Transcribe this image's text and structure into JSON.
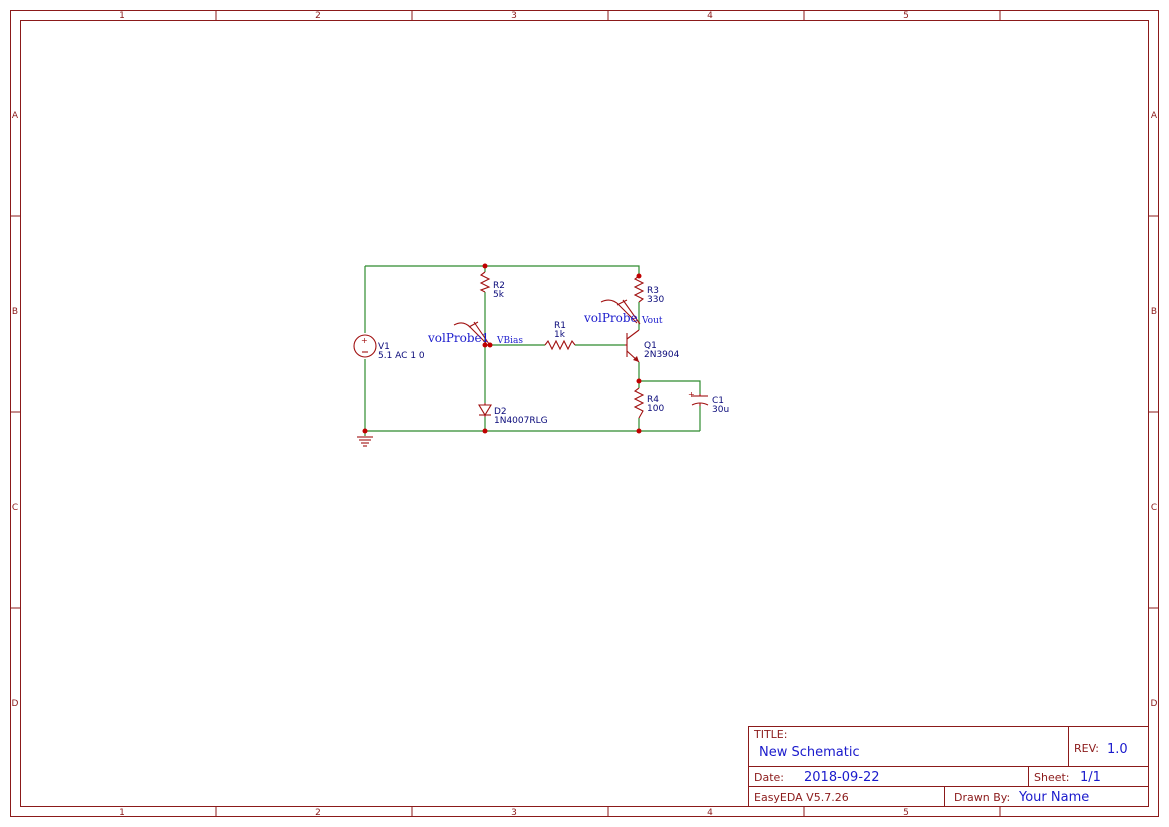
{
  "frame": {
    "col_labels": [
      "1",
      "2",
      "3",
      "4",
      "5"
    ],
    "row_labels": [
      "A",
      "B",
      "C",
      "D"
    ]
  },
  "components": {
    "v1": {
      "ref": "V1",
      "value": "5.1 AC 1 0"
    },
    "r2": {
      "ref": "R2",
      "value": "5k"
    },
    "r1": {
      "ref": "R1",
      "value": "1k"
    },
    "r3": {
      "ref": "R3",
      "value": "330"
    },
    "r4": {
      "ref": "R4",
      "value": "100"
    },
    "q1": {
      "ref": "Q1",
      "value": "2N3904"
    },
    "d2": {
      "ref": "D2",
      "value": "1N4007RLG"
    },
    "c1": {
      "ref": "C1",
      "value": "30u"
    }
  },
  "probes": {
    "probe1": {
      "name": "volProbe1",
      "net": "VBias"
    },
    "probe2": {
      "name": "volProbe",
      "net": "Vout"
    }
  },
  "title_block": {
    "title_key": "TITLE:",
    "title": "New Schematic",
    "rev_key": "REV:",
    "rev": "1.0",
    "date_key": "Date:",
    "date": "2018-09-22",
    "sheet_key": "Sheet:",
    "sheet": "1/1",
    "software": "EasyEDA V5.7.26",
    "drawn_key": "Drawn By:",
    "drawn_by": "Your Name"
  },
  "colors": {
    "frame": "#8b1a1a",
    "wire": "#2e8b2e",
    "component": "#a01010",
    "label": "#1a1acc"
  }
}
